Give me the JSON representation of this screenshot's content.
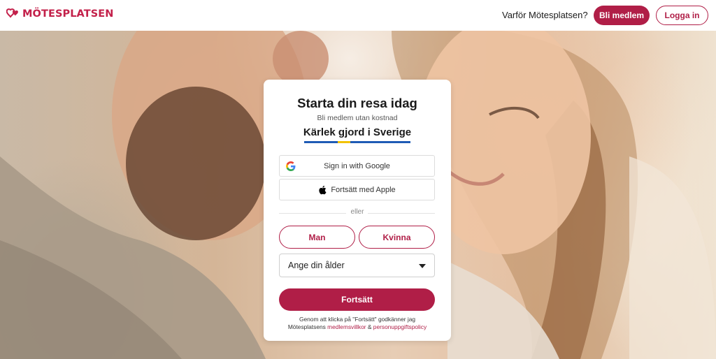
{
  "brand": {
    "name": "MÖTESPLATSEN",
    "color": "#c3204a",
    "accent_button": "#b01e47"
  },
  "nav": {
    "why_link": "Varför Mötesplatsen?",
    "join_button": "Bli medlem",
    "login_button": "Logga in"
  },
  "signup": {
    "title": "Starta din resa idag",
    "subtitle": "Bli medlem utan kostnad",
    "tagline": "Kärlek gjord i Sverige",
    "flag_colors": [
      "#1f5bb5",
      "#f2c200"
    ],
    "google_button": "Sign in with Google",
    "google_icon": "google-icon",
    "apple_button": "Fortsätt med Apple",
    "apple_icon": "apple-icon",
    "divider": "eller",
    "gender_man": "Man",
    "gender_woman": "Kvinna",
    "age_select": "Ange din ålder",
    "continue_button": "Fortsätt",
    "terms_prefix": "Genom att klicka på \"Fortsätt\" godkänner jag",
    "terms_company": "Mötesplatsens",
    "terms_link1": "medlemsvillkor",
    "terms_and": "&",
    "terms_link2": "personuppgiftspolicy"
  }
}
